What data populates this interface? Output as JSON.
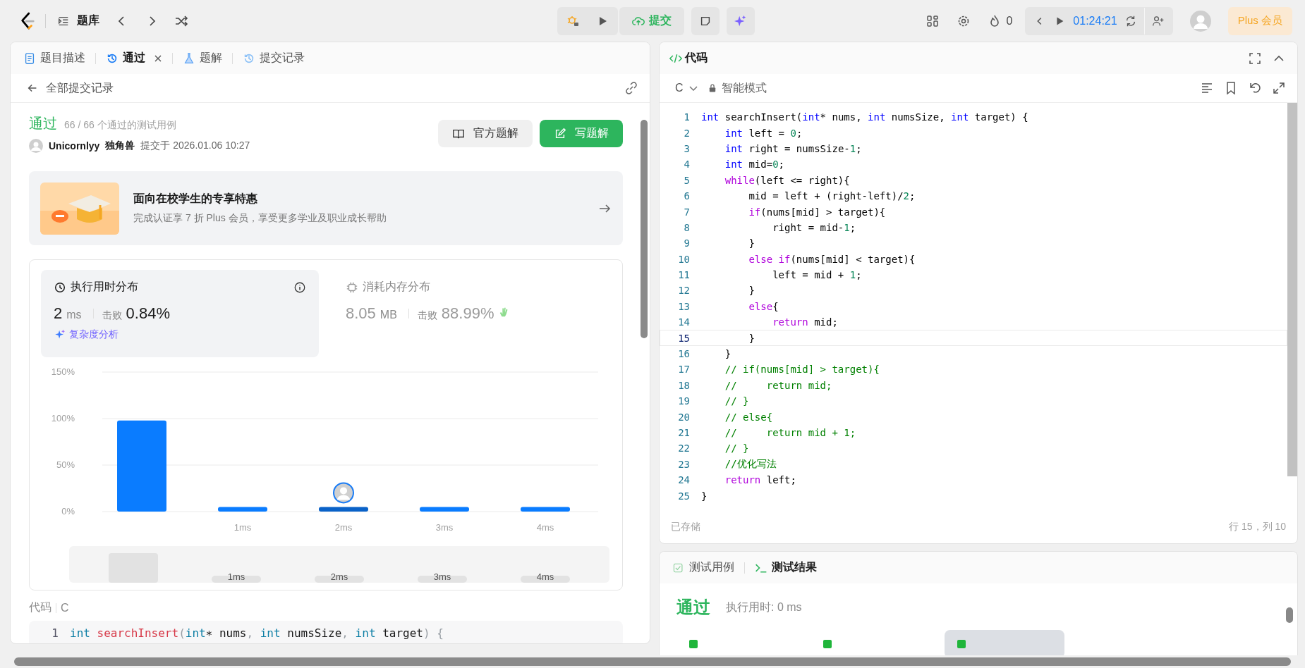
{
  "top_bar": {
    "library_label": "题库",
    "submit_label": "提交",
    "streak": "0",
    "timer": "01:24:21",
    "plus_label": "Plus 会员"
  },
  "left_panel": {
    "tabs": [
      {
        "label": "题目描述",
        "kind": "description",
        "selected": false,
        "closable": false
      },
      {
        "label": "通过",
        "kind": "submission",
        "selected": true,
        "closable": true
      },
      {
        "label": "题解",
        "kind": "solution",
        "selected": false,
        "closable": false
      },
      {
        "label": "提交记录",
        "kind": "history",
        "selected": false,
        "closable": false
      }
    ],
    "back_label": "全部提交记录",
    "result": {
      "status": "通过",
      "cases": "66 / 66 个通过的测试用例",
      "user": "Unicornlyy",
      "nickname": "独角兽",
      "submitted": "提交于 2026.01.06 10:27"
    },
    "buttons": [
      {
        "label": "官方题解",
        "kind": "secondary"
      },
      {
        "label": "写题解",
        "kind": "primary"
      }
    ],
    "promo": {
      "title": "面向在校学生的专享特惠",
      "text": "完成认证享 7 折 Plus 会员，享受更多学业及职业成长帮助"
    },
    "stats": [
      {
        "kind": "time",
        "title": "执行用时分布",
        "value": "2",
        "unit": "ms",
        "beat_label": "击败",
        "beat": "0.84%",
        "link": "复杂度分析",
        "selected": true
      },
      {
        "kind": "memory",
        "title": "消耗内存分布",
        "value": "8.05",
        "unit": "MB",
        "beat_label": "击败",
        "beat": "88.99%",
        "selected": false
      }
    ],
    "chart_data": {
      "type": "bar",
      "categories": [
        null,
        "1ms",
        "2ms",
        "3ms",
        "4ms"
      ],
      "values": [
        98,
        5,
        5,
        5,
        5
      ],
      "ylim": [
        0,
        150
      ],
      "yticks": [
        {
          "value": 0,
          "label": "0%"
        },
        {
          "value": 50,
          "label": "50%"
        },
        {
          "value": 100,
          "label": "100%"
        },
        {
          "value": 150,
          "label": "150%"
        }
      ]
    },
    "bars": [
      {
        "mine": false
      },
      {
        "mine": false
      },
      {
        "mine": true
      },
      {
        "mine": false
      },
      {
        "mine": false
      }
    ],
    "navigator_labels": [
      "1ms",
      "2ms",
      "3ms",
      "4ms"
    ],
    "code_label": "代码",
    "code_lang": "C",
    "code_preview": [
      {
        "number": "1",
        "tokens": [
          {
            "kind": "type",
            "text": "int "
          },
          {
            "kind": "func",
            "text": "searchInsert"
          },
          {
            "kind": "punct",
            "text": "("
          },
          {
            "kind": "type",
            "text": "int"
          },
          {
            "kind": "plain",
            "text": "∗ nums"
          },
          {
            "kind": "punct",
            "text": ", "
          },
          {
            "kind": "type",
            "text": "int"
          },
          {
            "kind": "plain",
            "text": " numsSize"
          },
          {
            "kind": "punct",
            "text": ", "
          },
          {
            "kind": "type",
            "text": "int"
          },
          {
            "kind": "plain",
            "text": " target"
          },
          {
            "kind": "punct",
            "text": ") {"
          }
        ]
      }
    ]
  },
  "editor": {
    "title": "代码",
    "language": "C",
    "mode": "智能模式",
    "status": "已存储",
    "cursor": "行 15，列 10",
    "lines": [
      {
        "number": "1",
        "current": false,
        "tokens": [
          {
            "kind": "type",
            "text": "int"
          },
          {
            "kind": "plain",
            "text": " searchInsert("
          },
          {
            "kind": "type",
            "text": "int"
          },
          {
            "kind": "plain",
            "text": "* nums, "
          },
          {
            "kind": "type",
            "text": "int"
          },
          {
            "kind": "plain",
            "text": " numsSize, "
          },
          {
            "kind": "type",
            "text": "int"
          },
          {
            "kind": "plain",
            "text": " target) {"
          }
        ]
      },
      {
        "number": "2",
        "current": false,
        "tokens": [
          {
            "kind": "type",
            "text": "    int"
          },
          {
            "kind": "plain",
            "text": " left = "
          },
          {
            "kind": "num",
            "text": "0"
          },
          {
            "kind": "plain",
            "text": ";"
          }
        ]
      },
      {
        "number": "3",
        "current": false,
        "tokens": [
          {
            "kind": "type",
            "text": "    int"
          },
          {
            "kind": "plain",
            "text": " right = numsSize-"
          },
          {
            "kind": "num",
            "text": "1"
          },
          {
            "kind": "plain",
            "text": ";"
          }
        ]
      },
      {
        "number": "4",
        "current": false,
        "tokens": [
          {
            "kind": "type",
            "text": "    int"
          },
          {
            "kind": "plain",
            "text": " mid="
          },
          {
            "kind": "num",
            "text": "0"
          },
          {
            "kind": "plain",
            "text": ";"
          }
        ]
      },
      {
        "number": "5",
        "current": false,
        "tokens": [
          {
            "kind": "control",
            "text": "    while"
          },
          {
            "kind": "plain",
            "text": "(left <= right){"
          }
        ]
      },
      {
        "number": "6",
        "current": false,
        "tokens": [
          {
            "kind": "plain",
            "text": "        mid = left + (right-left)/"
          },
          {
            "kind": "num",
            "text": "2"
          },
          {
            "kind": "plain",
            "text": ";"
          }
        ]
      },
      {
        "number": "7",
        "current": false,
        "tokens": [
          {
            "kind": "control",
            "text": "        if"
          },
          {
            "kind": "plain",
            "text": "(nums[mid] > target){"
          }
        ]
      },
      {
        "number": "8",
        "current": false,
        "tokens": [
          {
            "kind": "plain",
            "text": "            right = mid-"
          },
          {
            "kind": "num",
            "text": "1"
          },
          {
            "kind": "plain",
            "text": ";"
          }
        ]
      },
      {
        "number": "9",
        "current": false,
        "tokens": [
          {
            "kind": "plain",
            "text": "        }"
          }
        ]
      },
      {
        "number": "10",
        "current": false,
        "tokens": [
          {
            "kind": "control",
            "text": "        else if"
          },
          {
            "kind": "plain",
            "text": "(nums[mid] < target){"
          }
        ]
      },
      {
        "number": "11",
        "current": false,
        "tokens": [
          {
            "kind": "plain",
            "text": "            left = mid + "
          },
          {
            "kind": "num",
            "text": "1"
          },
          {
            "kind": "plain",
            "text": ";"
          }
        ]
      },
      {
        "number": "12",
        "current": false,
        "tokens": [
          {
            "kind": "plain",
            "text": "        }"
          }
        ]
      },
      {
        "number": "13",
        "current": false,
        "tokens": [
          {
            "kind": "control",
            "text": "        else"
          },
          {
            "kind": "plain",
            "text": "{"
          }
        ]
      },
      {
        "number": "14",
        "current": false,
        "tokens": [
          {
            "kind": "control",
            "text": "            return"
          },
          {
            "kind": "plain",
            "text": " mid;"
          }
        ]
      },
      {
        "number": "15",
        "current": true,
        "tokens": [
          {
            "kind": "plain",
            "text": "        }"
          }
        ]
      },
      {
        "number": "16",
        "current": false,
        "tokens": [
          {
            "kind": "plain",
            "text": "    }"
          }
        ]
      },
      {
        "number": "17",
        "current": false,
        "tokens": [
          {
            "kind": "comment",
            "text": "    // if(nums[mid] > target){"
          }
        ]
      },
      {
        "number": "18",
        "current": false,
        "tokens": [
          {
            "kind": "comment",
            "text": "    //     return mid;"
          }
        ]
      },
      {
        "number": "19",
        "current": false,
        "tokens": [
          {
            "kind": "comment",
            "text": "    // }"
          }
        ]
      },
      {
        "number": "20",
        "current": false,
        "tokens": [
          {
            "kind": "comment",
            "text": "    // else{"
          }
        ]
      },
      {
        "number": "21",
        "current": false,
        "tokens": [
          {
            "kind": "comment",
            "text": "    //     return mid + 1;"
          }
        ]
      },
      {
        "number": "22",
        "current": false,
        "tokens": [
          {
            "kind": "comment",
            "text": "    // }"
          }
        ]
      },
      {
        "number": "23",
        "current": false,
        "tokens": [
          {
            "kind": "comment",
            "text": "    //优化写法"
          }
        ]
      },
      {
        "number": "24",
        "current": false,
        "tokens": [
          {
            "kind": "control",
            "text": "    return"
          },
          {
            "kind": "plain",
            "text": " left;"
          }
        ]
      },
      {
        "number": "25",
        "current": false,
        "tokens": [
          {
            "kind": "plain",
            "text": "}"
          }
        ]
      }
    ]
  },
  "test_panel": {
    "tabs": [
      {
        "label": "测试用例",
        "kind": "cases",
        "selected": false
      },
      {
        "label": "测试结果",
        "kind": "result",
        "selected": true
      }
    ],
    "status": "通过",
    "runtime": "执行用时: 0 ms",
    "cases": [
      {
        "passed": true,
        "selected": false
      },
      {
        "passed": true,
        "selected": false
      },
      {
        "passed": true,
        "selected": true
      }
    ]
  }
}
